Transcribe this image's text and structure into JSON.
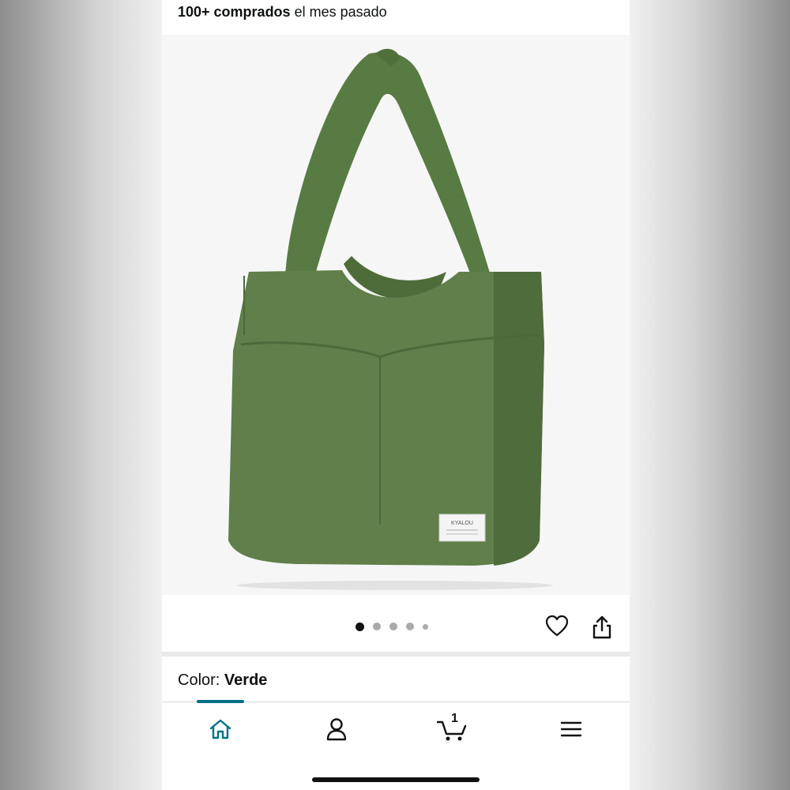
{
  "header": {
    "bought_count": "100+ comprados",
    "bought_suffix": "el mes pasado"
  },
  "product_image": {
    "alt": "Green canvas tote bag",
    "label_brand": "KYALOU",
    "bag_color": "#5e8049"
  },
  "carousel": {
    "total_dots": 5,
    "active_index": 0
  },
  "actions": {
    "like_icon": "heart-icon",
    "share_icon": "share-icon"
  },
  "variant": {
    "label": "Color:",
    "value": "Verde"
  },
  "bottom_nav": {
    "items": [
      {
        "name": "home",
        "icon": "home-icon",
        "active": true
      },
      {
        "name": "account",
        "icon": "person-icon"
      },
      {
        "name": "cart",
        "icon": "cart-icon",
        "count": "1"
      },
      {
        "name": "menu",
        "icon": "menu-icon"
      }
    ],
    "accent_color": "#007185"
  }
}
